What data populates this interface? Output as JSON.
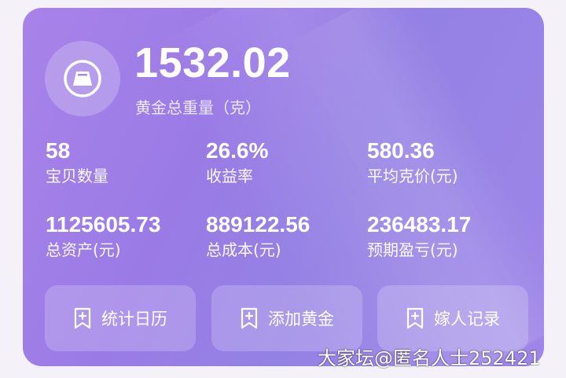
{
  "summary": {
    "total_weight": "1532.02",
    "total_weight_label": "黄金总重量（克）"
  },
  "stats": [
    {
      "value": "58",
      "label": "宝贝数量"
    },
    {
      "value": "26.6%",
      "label": "收益率"
    },
    {
      "value": "580.36",
      "label": "平均克价(元)"
    },
    {
      "value": "1125605.73",
      "label": "总资产(元)"
    },
    {
      "value": "889122.56",
      "label": "总成本(元)"
    },
    {
      "value": "236483.17",
      "label": "预期盈亏(元)"
    }
  ],
  "actions": [
    {
      "label": "统计日历",
      "icon": "bookmark-plus-icon"
    },
    {
      "label": "添加黄金",
      "icon": "bookmark-plus-icon"
    },
    {
      "label": "嫁人记录",
      "icon": "bookmark-plus-icon"
    }
  ],
  "watermark": "大家坛@匿名人士252421",
  "colors": {
    "card_start": "#a883e8",
    "card_end": "#9481e4",
    "text": "#ffffff"
  }
}
